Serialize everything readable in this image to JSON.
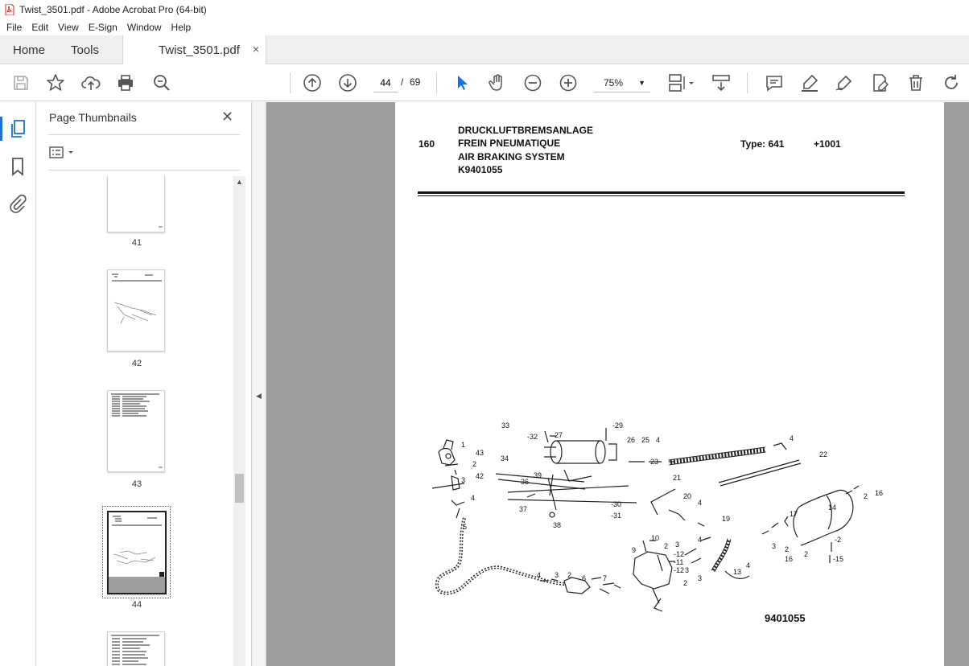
{
  "window": {
    "title": "Twist_3501.pdf - Adobe Acrobat Pro (64-bit)"
  },
  "menu": [
    "File",
    "Edit",
    "View",
    "E-Sign",
    "Window",
    "Help"
  ],
  "tabs": {
    "home": "Home",
    "tools": "Tools",
    "document": "Twist_3501.pdf",
    "close": "×"
  },
  "toolbar": {
    "current_page": "44",
    "page_separator": "/",
    "total_pages": "69",
    "zoom": "75%"
  },
  "panel": {
    "title": "Page Thumbnails",
    "close": "✕",
    "thumbnails": [
      {
        "number": "41"
      },
      {
        "number": "42"
      },
      {
        "number": "43"
      },
      {
        "number": "44"
      },
      {
        "number": ""
      }
    ]
  },
  "document": {
    "section_number": "160",
    "title_de": "DRUCKLUFTBREMSANLAGE",
    "title_fr": "FREIN PNEUMATIQUE",
    "title_en": "AIR BRAKING SYSTEM",
    "code": "K9401055",
    "type": "Type: 641",
    "serial": "+1001",
    "figure_number": "9401055",
    "callouts": [
      "1",
      "2",
      "3",
      "4",
      "5",
      "6",
      "7",
      "8",
      "9",
      "10",
      "11",
      "12",
      "13",
      "14",
      "15",
      "16",
      "17",
      "19",
      "20",
      "21",
      "22",
      "23",
      "25",
      "26",
      "27",
      "29",
      "30",
      "31",
      "32",
      "33",
      "34",
      "36",
      "37",
      "38",
      "39",
      "42",
      "43"
    ]
  },
  "colors": {
    "accent": "#1473e6",
    "doc_background": "#9e9e9e",
    "pdf_red": "#d7201e"
  }
}
